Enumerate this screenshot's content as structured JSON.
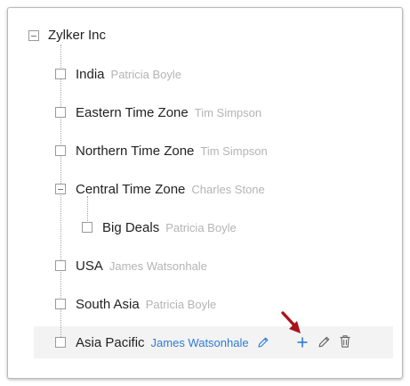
{
  "tree": {
    "root": {
      "label": "Zylker Inc"
    },
    "nodes": [
      {
        "name": "India",
        "owner": "Patricia Boyle"
      },
      {
        "name": "Eastern Time Zone",
        "owner": "Tim Simpson"
      },
      {
        "name": "Northern Time Zone",
        "owner": "Tim Simpson"
      },
      {
        "name": "Central Time Zone",
        "owner": "Charles Stone"
      },
      {
        "name": "Big Deals",
        "owner": "Patricia Boyle"
      },
      {
        "name": "USA",
        "owner": "James Watsonhale"
      },
      {
        "name": "South Asia",
        "owner": "Patricia Boyle"
      },
      {
        "name": "Asia Pacific",
        "owner": "James Watsonhale"
      }
    ]
  },
  "icons": {
    "edit_owner": "pencil-icon",
    "add": "plus-icon",
    "edit": "pencil-icon",
    "delete": "trash-icon",
    "pointer": "red-arrow-annotation"
  },
  "colors": {
    "link": "#2f7bd4",
    "owner_muted": "#b4b4b4",
    "arrow": "#a8141c",
    "hover_row": "#f3f3f3"
  }
}
